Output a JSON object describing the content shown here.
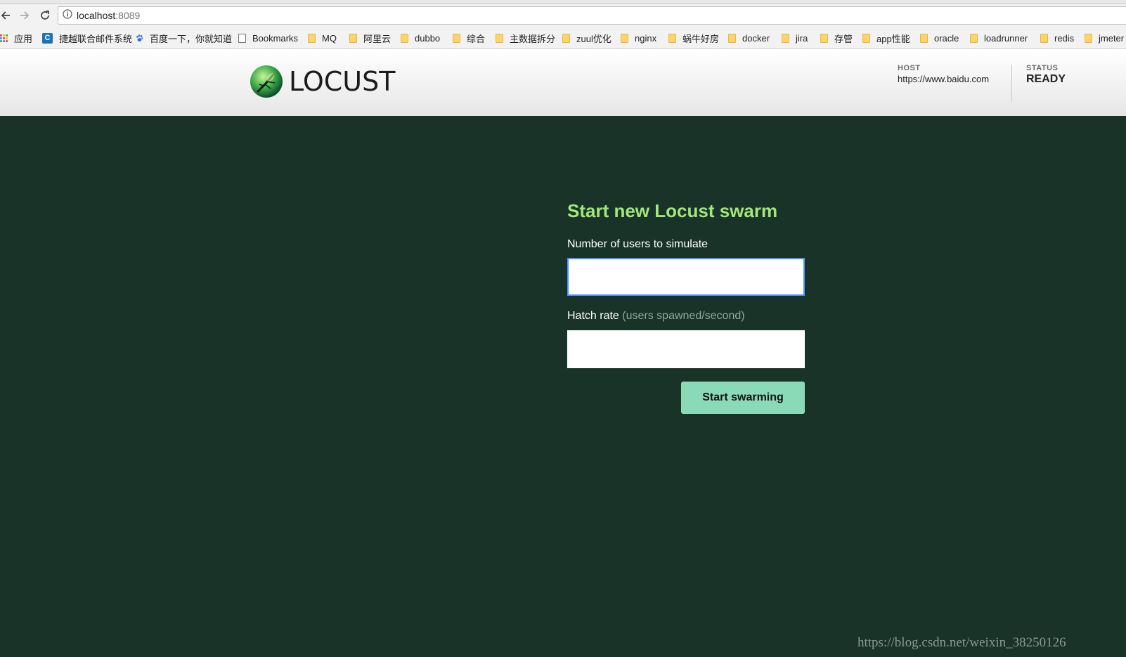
{
  "browser": {
    "url_host": "localhost",
    "url_port": ":8089",
    "bookmarks": [
      {
        "label": "应用",
        "icon": "apps-grid-icon"
      },
      {
        "label": "捷越联合邮件系统",
        "icon": "c-logo-icon"
      },
      {
        "label": "百度一下，你就知道",
        "icon": "baidu-paw-icon"
      },
      {
        "label": "Bookmarks",
        "icon": "page-icon"
      },
      {
        "label": "MQ",
        "icon": "folder-icon"
      },
      {
        "label": "阿里云",
        "icon": "folder-icon"
      },
      {
        "label": "dubbo",
        "icon": "folder-icon"
      },
      {
        "label": "综合",
        "icon": "folder-icon"
      },
      {
        "label": "主数据拆分",
        "icon": "folder-icon"
      },
      {
        "label": "zuul优化",
        "icon": "folder-icon"
      },
      {
        "label": "nginx",
        "icon": "folder-icon"
      },
      {
        "label": "蜗牛好房",
        "icon": "folder-icon"
      },
      {
        "label": "docker",
        "icon": "folder-icon"
      },
      {
        "label": "jira",
        "icon": "folder-icon"
      },
      {
        "label": "存管",
        "icon": "folder-icon"
      },
      {
        "label": "app性能",
        "icon": "folder-icon"
      },
      {
        "label": "oracle",
        "icon": "folder-icon"
      },
      {
        "label": "loadrunner",
        "icon": "folder-icon"
      },
      {
        "label": "redis",
        "icon": "folder-icon"
      },
      {
        "label": "jmeter",
        "icon": "folder-icon"
      }
    ]
  },
  "header": {
    "logo_text": "LOCUST",
    "host_label": "HOST",
    "host_value": "https://www.baidu.com",
    "status_label": "STATUS",
    "status_value": "READY"
  },
  "form": {
    "title": "Start new Locust swarm",
    "users_label": "Number of users to simulate",
    "users_value": "",
    "hatch_label": "Hatch rate",
    "hatch_hint": "(users spawned/second)",
    "hatch_value": "",
    "submit_label": "Start swarming"
  },
  "watermark": "https://blog.csdn.net/weixin_38250126",
  "colors": {
    "page_bg": "#1a3328",
    "title_green": "#a1e878",
    "button_bg": "#8ad9b7",
    "focus_border": "#4d90fe"
  }
}
